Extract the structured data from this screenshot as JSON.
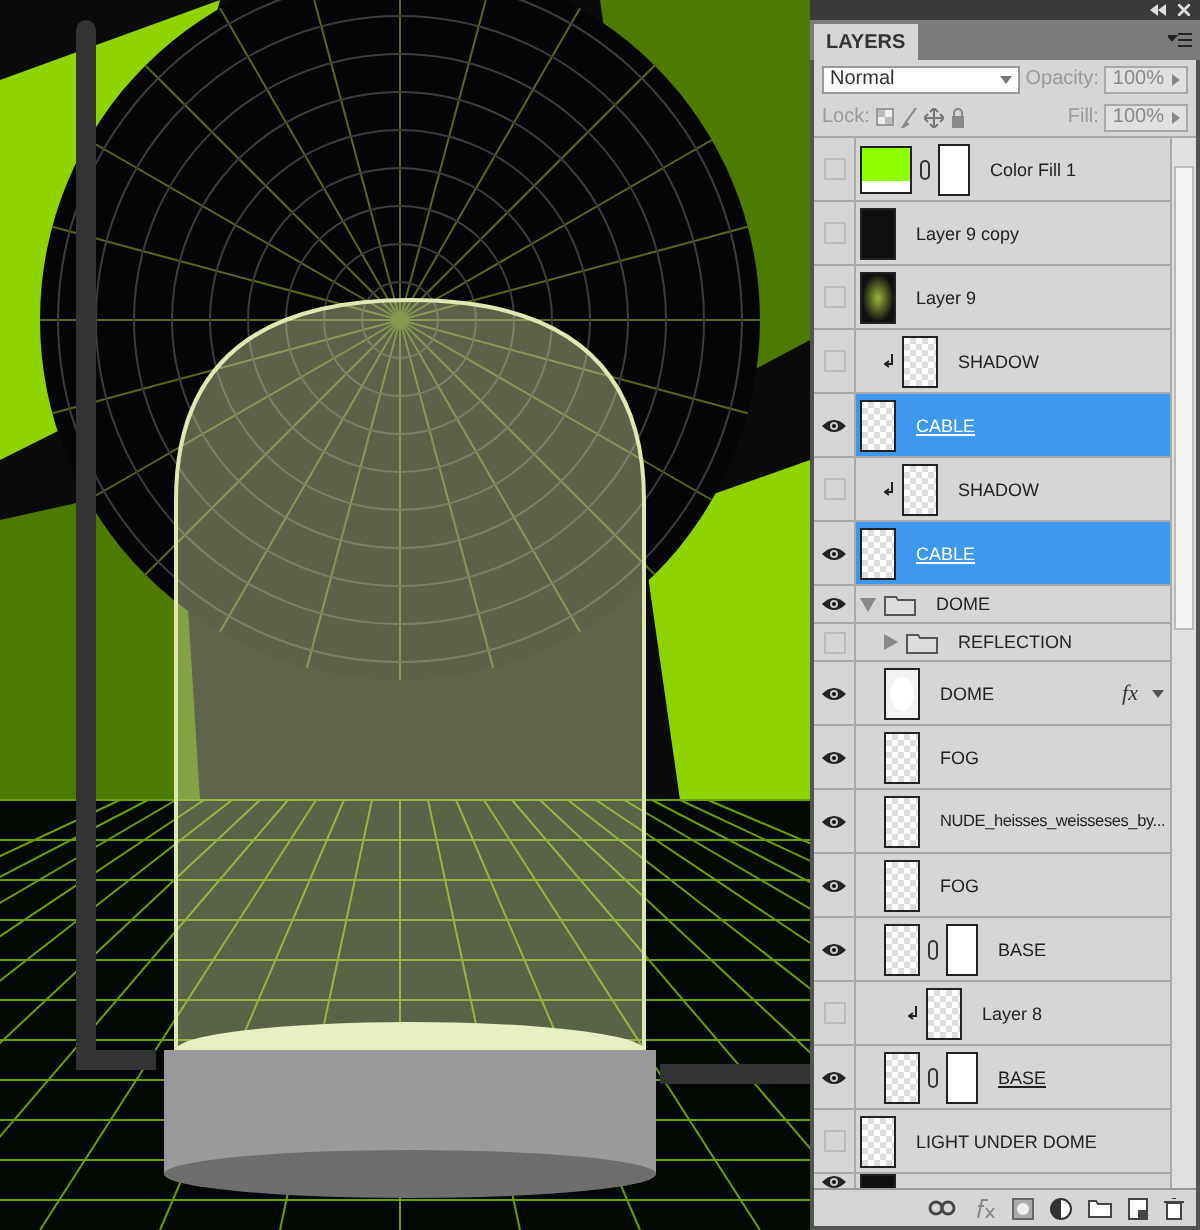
{
  "panel": {
    "title": "LAYERS",
    "blend_mode": "Normal",
    "opacity_label": "Opacity:",
    "opacity": "100%",
    "lock_label": "Lock:",
    "fill_label": "Fill:",
    "fill": "100%"
  },
  "layers": [
    {
      "kind": "layer",
      "name": "Color Fill 1",
      "thumbnail": {
        "kind": "color-fill"
      },
      "mask": true,
      "visible": false,
      "selected": false
    },
    {
      "kind": "layer",
      "name": "Layer 9 copy",
      "thumbnail": {
        "kind": "dark-image"
      },
      "visible": false,
      "selected": false
    },
    {
      "kind": "layer",
      "name": "Layer 9",
      "thumbnail": {
        "kind": "green-image"
      },
      "visible": false,
      "selected": false
    },
    {
      "kind": "layer",
      "name": "SHADOW",
      "thumbnail": {
        "kind": "transparent"
      },
      "clipped": true,
      "visible": false,
      "selected": false
    },
    {
      "kind": "layer",
      "name": "CABLE",
      "thumbnail": {
        "kind": "transparent"
      },
      "clip_base": true,
      "visible": true,
      "selected": true
    },
    {
      "kind": "layer",
      "name": "SHADOW",
      "thumbnail": {
        "kind": "transparent"
      },
      "clipped": true,
      "visible": false,
      "selected": false
    },
    {
      "kind": "layer",
      "name": "CABLE",
      "thumbnail": {
        "kind": "transparent"
      },
      "clip_base": true,
      "visible": true,
      "selected": true
    },
    {
      "kind": "group",
      "name": "DOME",
      "expanded": true,
      "visible": true,
      "selected": false,
      "children": [
        {
          "kind": "group",
          "name": "REFLECTION",
          "expanded": false,
          "visible": false,
          "selected": false
        },
        {
          "kind": "layer",
          "name": "DOME",
          "thumbnail": {
            "kind": "white-shape"
          },
          "effects_label": "fx",
          "visible": true,
          "selected": false
        },
        {
          "kind": "layer",
          "name": "FOG",
          "thumbnail": {
            "kind": "transparent"
          },
          "visible": true,
          "selected": false
        },
        {
          "kind": "layer",
          "name": "NUDE_heisses_weisseses_by...",
          "thumbnail": {
            "kind": "transparent"
          },
          "visible": true,
          "selected": false
        },
        {
          "kind": "layer",
          "name": "FOG",
          "thumbnail": {
            "kind": "transparent"
          },
          "visible": true,
          "selected": false
        },
        {
          "kind": "layer",
          "name": "BASE",
          "thumbnail": {
            "kind": "transparent"
          },
          "mask": true,
          "visible": true,
          "selected": false
        },
        {
          "kind": "layer",
          "name": "Layer 8",
          "thumbnail": {
            "kind": "transparent"
          },
          "clipped": true,
          "visible": false,
          "selected": false
        },
        {
          "kind": "layer",
          "name": "BASE",
          "thumbnail": {
            "kind": "transparent"
          },
          "mask": true,
          "clip_base": true,
          "visible": true,
          "selected": false
        }
      ]
    },
    {
      "kind": "layer",
      "name": "LIGHT UNDER DOME",
      "thumbnail": {
        "kind": "transparent"
      },
      "visible": false,
      "selected": false
    },
    {
      "kind": "layer",
      "thumbnail": {
        "kind": "dark-image"
      },
      "visible": true,
      "selected": false
    }
  ]
}
